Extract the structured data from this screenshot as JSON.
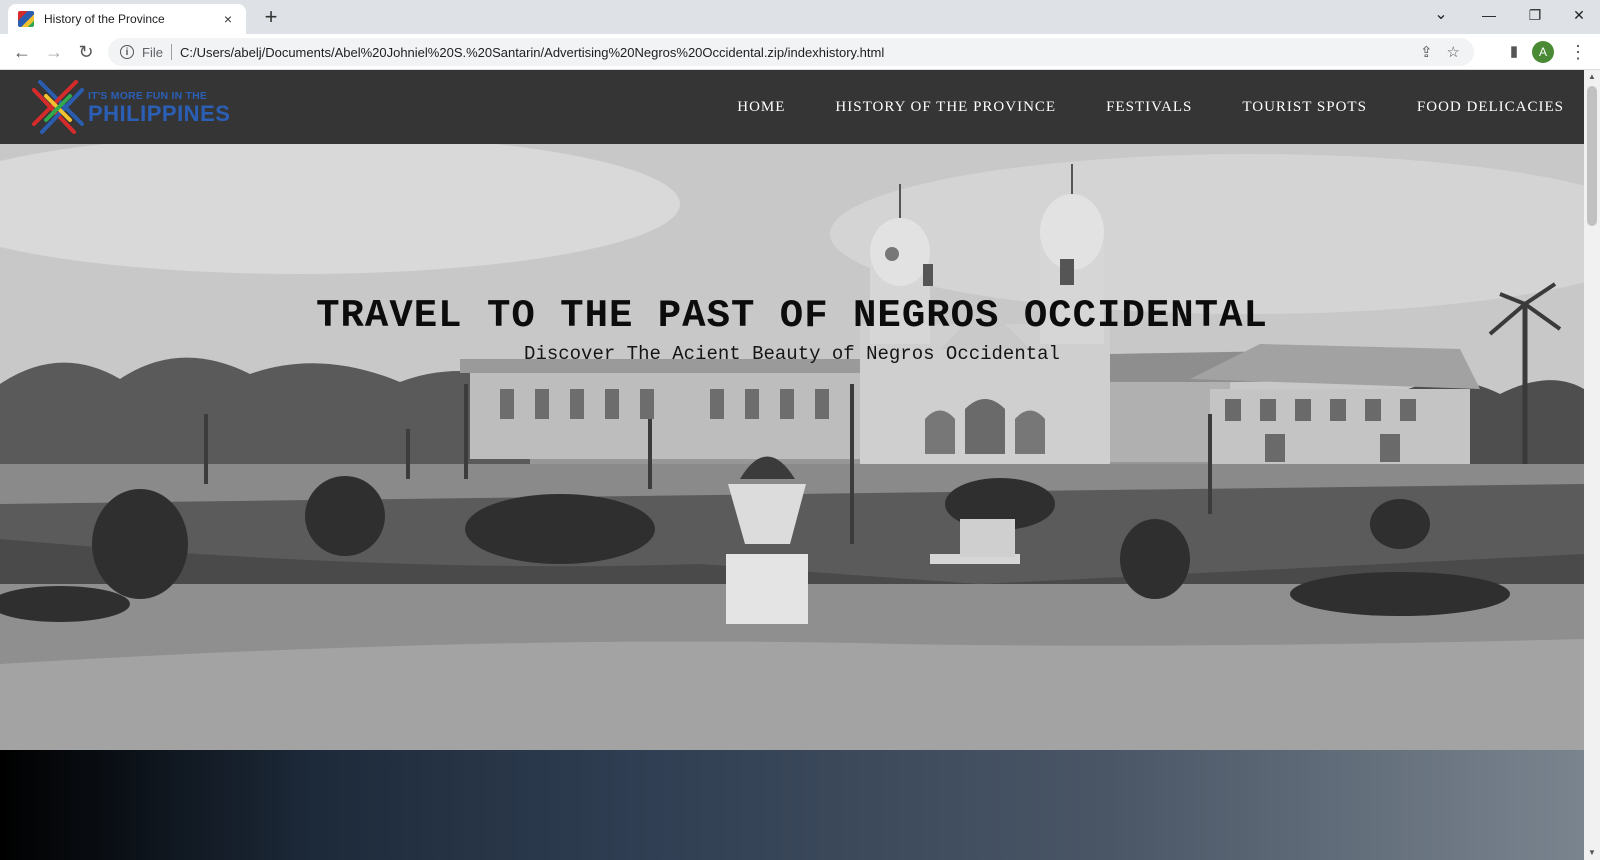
{
  "browser": {
    "tab_title": "History of the Province",
    "tab_close_icon": "×",
    "new_tab_icon": "+",
    "tab_search_icon": "⌄",
    "minimize_icon": "—",
    "restore_icon": "❐",
    "close_icon": "✕",
    "back_icon": "←",
    "forward_icon": "→",
    "reload_icon": "↻",
    "info_icon": "i",
    "scheme_label": "File",
    "url": "C:/Users/abelj/Documents/Abel%20Johniel%20S.%20Santarin/Advertising%20Negros%20Occidental.zip/indexhistory.html",
    "share_icon": "⇪",
    "bookmark_icon": "☆",
    "side_panel_icon": "▮",
    "profile_initial": "A",
    "menu_icon": "⋮"
  },
  "site": {
    "logo_line1": "IT'S MORE FUN IN THE",
    "logo_line2": "PHILIPPINES",
    "nav": {
      "home": "HOME",
      "history": "HISTORY OF THE PROVINCE",
      "festivals": "FESTIVALS",
      "tourist_spots": "TOURIST SPOTS",
      "food": "FOOD DELICACIES"
    },
    "hero": {
      "title": "TRAVEL TO THE PAST OF NEGROS OCCIDENTAL",
      "subtitle": "Discover The Acient Beauty of Negros Occidental"
    }
  },
  "scrollbar": {
    "up_icon": "▲",
    "down_icon": "▼"
  }
}
